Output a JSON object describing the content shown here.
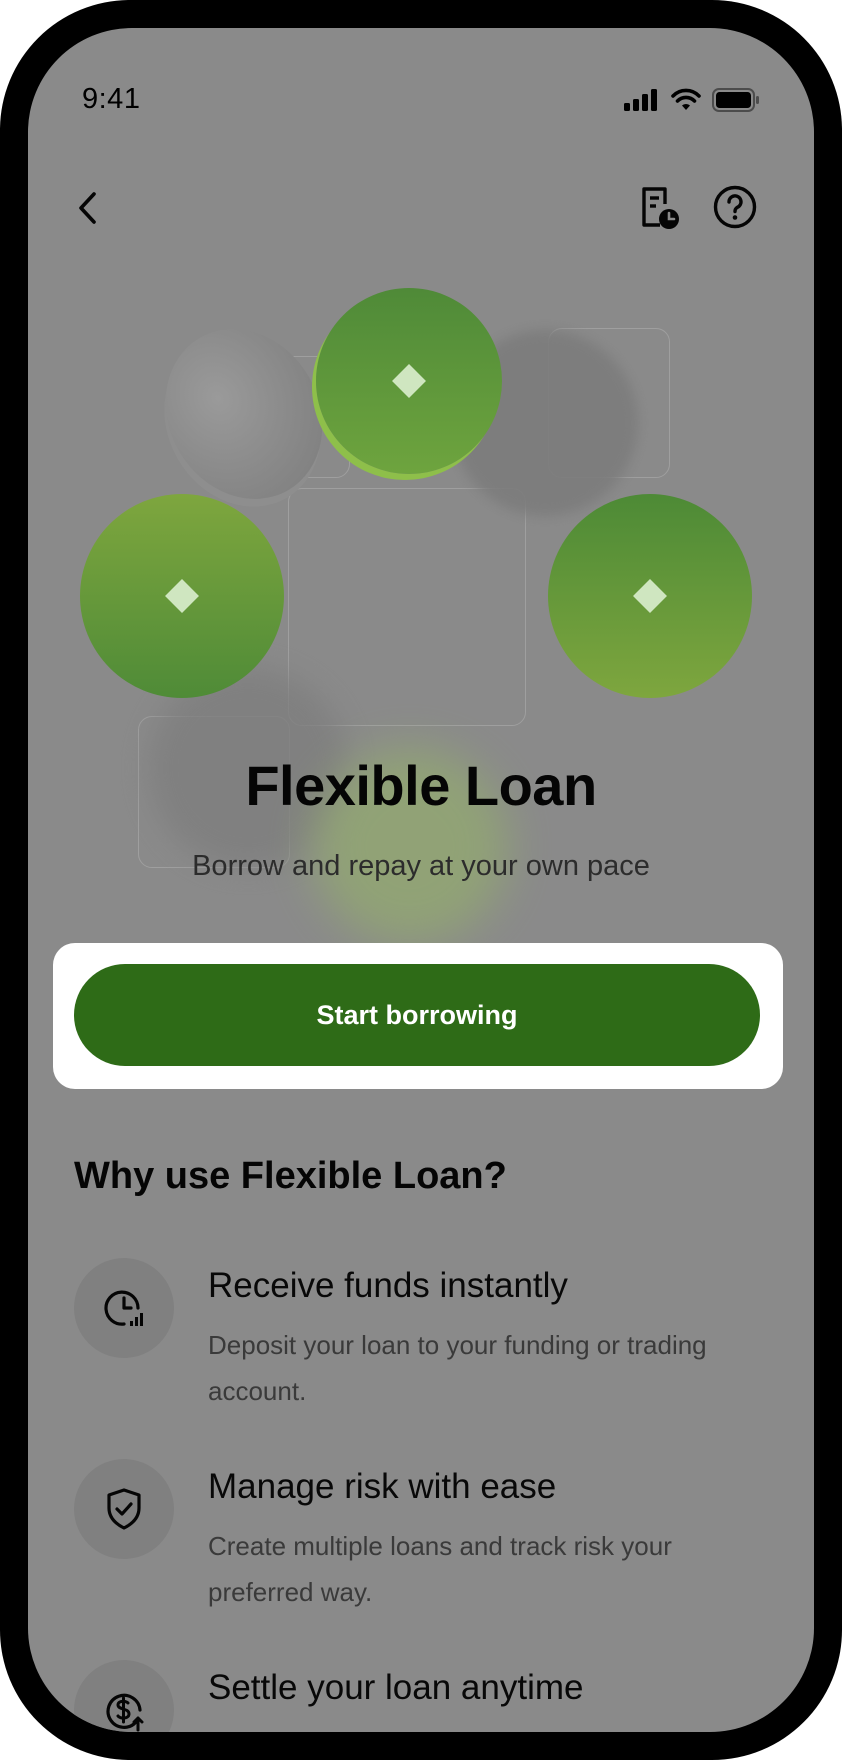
{
  "status_bar": {
    "time": "9:41",
    "icons": [
      "cellular-signal-icon",
      "wifi-icon",
      "battery-icon"
    ]
  },
  "nav": {
    "icons": [
      "chevron-left-icon",
      "document-clock-icon",
      "question-circle-icon"
    ]
  },
  "hero": {
    "title": "Flexible Loan",
    "subtitle": "Borrow and repay at your own pace"
  },
  "cta": {
    "label": "Start borrowing"
  },
  "why": {
    "heading": "Why use Flexible Loan?",
    "items": [
      {
        "icon": "clock-signal-icon",
        "title": "Receive funds instantly",
        "description": "Deposit your loan to your funding or trading account."
      },
      {
        "icon": "shield-check-icon",
        "title": "Manage risk with ease",
        "description": "Create multiple loans and track risk your preferred way."
      },
      {
        "icon": "dollar-arrow-icon",
        "title": "Settle your loan anytime",
        "description": ""
      }
    ]
  },
  "colors": {
    "accent_green": "#2e6b17",
    "screen_overlay": "#8a8a8a",
    "coin_green_light": "#7ea63e",
    "coin_green_dark": "#4e8a36"
  }
}
